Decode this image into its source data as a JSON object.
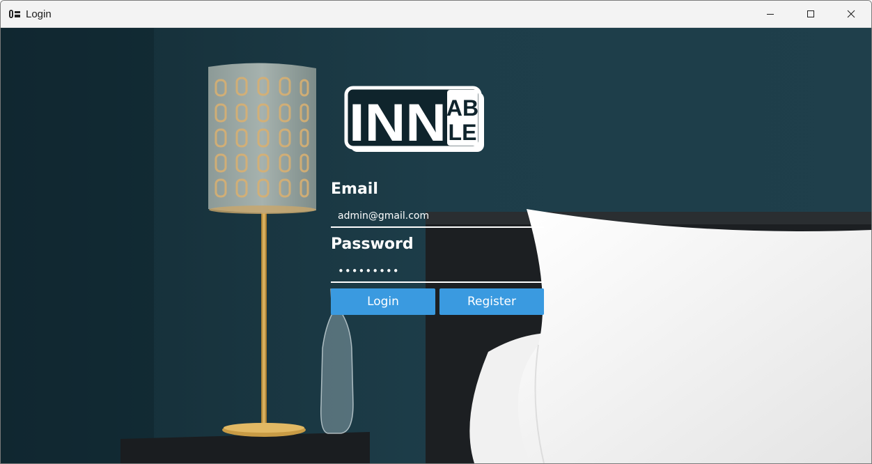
{
  "window": {
    "title": "Login",
    "app_icon": "hotel-app-icon",
    "controls": [
      "minimize-icon",
      "maximize-icon",
      "close-icon"
    ]
  },
  "logo": {
    "part1": "INN",
    "part2_top": "AB",
    "part2_bottom": "LE"
  },
  "form": {
    "email_label": "Email",
    "email_value": "admin@gmail.com",
    "password_label": "Password",
    "password_value": "•••••••••",
    "login_label": "Login",
    "register_label": "Register"
  },
  "colors": {
    "button": "#3a9ae0",
    "wall": "#1b3a45",
    "text": "#ffffff"
  }
}
